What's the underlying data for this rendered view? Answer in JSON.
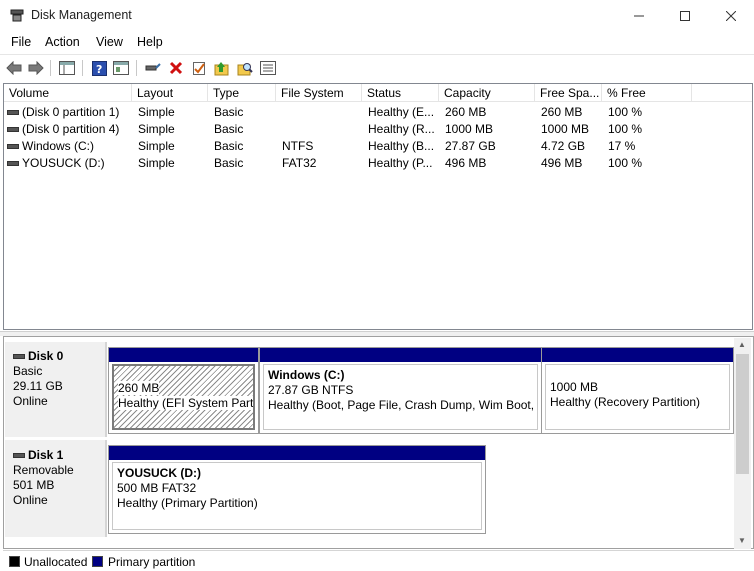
{
  "window": {
    "title": "Disk Management"
  },
  "menu": [
    "File",
    "Action",
    "View",
    "Help"
  ],
  "toolbar": {
    "icons": [
      "back-arrow-icon",
      "forward-arrow-icon",
      "console-tree-icon",
      "help-icon",
      "properties-icon",
      "connect-icon",
      "delete-icon",
      "checklist-icon",
      "folder-up-icon",
      "search-folder-icon",
      "list-view-icon"
    ]
  },
  "volumes": {
    "columns": [
      "Volume",
      "Layout",
      "Type",
      "File System",
      "Status",
      "Capacity",
      "Free Spa...",
      "% Free"
    ],
    "rows": [
      {
        "volume": "(Disk 0 partition 1)",
        "layout": "Simple",
        "type": "Basic",
        "fs": "",
        "status": "Healthy (E...",
        "capacity": "260 MB",
        "free": "260 MB",
        "pct": "100 %"
      },
      {
        "volume": "(Disk 0 partition 4)",
        "layout": "Simple",
        "type": "Basic",
        "fs": "",
        "status": "Healthy (R...",
        "capacity": "1000 MB",
        "free": "1000 MB",
        "pct": "100 %"
      },
      {
        "volume": "Windows (C:)",
        "layout": "Simple",
        "type": "Basic",
        "fs": "NTFS",
        "status": "Healthy (B...",
        "capacity": "27.87 GB",
        "free": "4.72 GB",
        "pct": "17 %"
      },
      {
        "volume": "YOUSUCK (D:)",
        "layout": "Simple",
        "type": "Basic",
        "fs": "FAT32",
        "status": "Healthy (P...",
        "capacity": "496 MB",
        "free": "496 MB",
        "pct": "100 %"
      }
    ]
  },
  "disks": [
    {
      "name": "Disk 0",
      "type": "Basic",
      "size": "29.11 GB",
      "state": "Online",
      "partitions": [
        {
          "title": "",
          "size": "260 MB",
          "status": "Healthy (EFI System Partit"
        },
        {
          "title": "Windows  (C:)",
          "size": "27.87 GB NTFS",
          "status": "Healthy (Boot, Page File, Crash Dump, Wim Boot, P"
        },
        {
          "title": "",
          "size": "1000 MB",
          "status": "Healthy (Recovery Partition)"
        }
      ]
    },
    {
      "name": "Disk 1",
      "type": "Removable",
      "size": "501 MB",
      "state": "Online",
      "partitions": [
        {
          "title": "YOUSUCK  (D:)",
          "size": "500 MB FAT32",
          "status": "Healthy (Primary Partition)"
        }
      ]
    }
  ],
  "legend": [
    {
      "label": "Unallocated",
      "color": "#000000"
    },
    {
      "label": "Primary partition",
      "color": "#000082"
    }
  ]
}
